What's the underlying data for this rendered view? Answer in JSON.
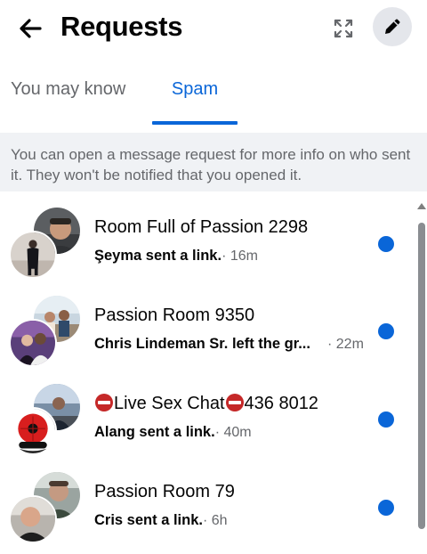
{
  "header": {
    "title": "Requests",
    "back_icon": "back-arrow-icon",
    "expand_icon": "expand-icon",
    "edit_icon": "pencil-icon"
  },
  "tabs": [
    {
      "label": "You may know",
      "active": false
    },
    {
      "label": "Spam",
      "active": true
    }
  ],
  "info_text": "You can open a message request for more info on who sent it. They won't be notified that you opened it.",
  "requests": [
    {
      "name": "Room Full of Passion 2298",
      "name_prefix": "",
      "name_suffix": "",
      "preview": "Şeyma sent a link.",
      "time": "· 16m",
      "unread": true
    },
    {
      "name": "Passion Room 9350",
      "name_prefix": "",
      "name_suffix": "",
      "preview": "Chris Lindeman Sr. left the gr...",
      "time": "· 22m",
      "unread": true
    },
    {
      "name": "",
      "name_prefix": "Live Sex Chat",
      "name_suffix": "436 8012",
      "preview": "Alang sent a link.",
      "time": "· 40m",
      "unread": true
    },
    {
      "name": "Passion Room 79",
      "name_prefix": "",
      "name_suffix": "",
      "preview": "Cris sent a link.",
      "time": "· 6h",
      "unread": true
    }
  ],
  "colors": {
    "accent": "#0a66d8",
    "muted_text": "#65676b",
    "info_bg": "#f0f2f5",
    "noentry_emoji": "#c52828"
  }
}
